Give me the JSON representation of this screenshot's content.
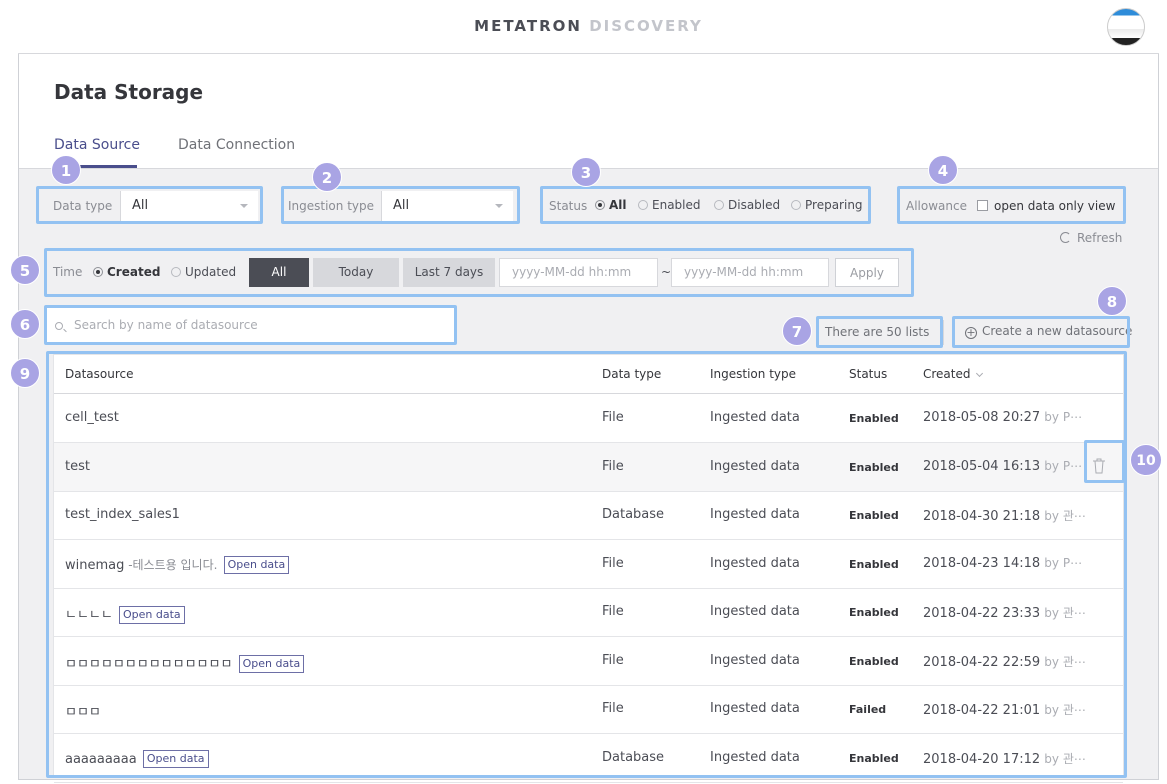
{
  "header": {
    "logo_part1": "METATRON",
    "logo_part2": "DISCOVERY"
  },
  "page": {
    "title": "Data Storage",
    "tabs": [
      {
        "label": "Data Source",
        "active": true
      },
      {
        "label": "Data Connection",
        "active": false
      }
    ]
  },
  "badges": [
    "1",
    "2",
    "3",
    "4",
    "5",
    "6",
    "7",
    "8",
    "9",
    "10"
  ],
  "filters": {
    "data_type": {
      "label": "Data type",
      "value": "All"
    },
    "ingestion_type": {
      "label": "Ingestion type",
      "value": "All"
    },
    "status": {
      "label": "Status",
      "options": [
        "All",
        "Enabled",
        "Disabled",
        "Preparing"
      ],
      "selected": "All"
    },
    "allowance": {
      "label": "Allowance",
      "checkbox_label": "open data only view",
      "checked": false
    },
    "refresh_label": "Refresh",
    "time": {
      "label": "Time",
      "options": [
        "Created",
        "Updated"
      ],
      "selected": "Created",
      "buttons": [
        "All",
        "Today",
        "Last 7 days"
      ],
      "active_button": "All",
      "from_placeholder": "yyyy-MM-dd hh:mm",
      "to_placeholder": "yyyy-MM-dd hh:mm",
      "separator": "~",
      "apply_label": "Apply"
    }
  },
  "search": {
    "placeholder": "Search by name of datasource"
  },
  "list_count": "There are 50 lists",
  "create_label": "Create a new datasource",
  "table": {
    "columns": [
      "Datasource",
      "Data type",
      "Ingestion type",
      "Status",
      "Created"
    ],
    "open_data_tag": "Open data",
    "rows": [
      {
        "name": "cell_test",
        "desc": "",
        "open": false,
        "type": "File",
        "ingestion": "Ingested data",
        "status": "Enabled",
        "created": "2018-05-08 20:27",
        "by": "by P⋯"
      },
      {
        "name": "test",
        "desc": "",
        "open": false,
        "type": "File",
        "ingestion": "Ingested data",
        "status": "Enabled",
        "created": "2018-05-04 16:13",
        "by": "by P⋯"
      },
      {
        "name": "test_index_sales1",
        "desc": "",
        "open": false,
        "type": "Database",
        "ingestion": "Ingested data",
        "status": "Enabled",
        "created": "2018-04-30 21:18",
        "by": "by 관⋯"
      },
      {
        "name": "winemag",
        "desc": " -테스트용 입니다.",
        "open": true,
        "type": "File",
        "ingestion": "Ingested data",
        "status": "Enabled",
        "created": "2018-04-23 14:18",
        "by": "by P⋯"
      },
      {
        "name": "ㄴㄴㄴㄴ",
        "desc": "",
        "open": true,
        "type": "File",
        "ingestion": "Ingested data",
        "status": "Enabled",
        "created": "2018-04-22 23:33",
        "by": "by 관⋯"
      },
      {
        "name": "ㅁㅁㅁㅁㅁㅁㅁㅁㅁㅁㅁㅁㅁㅁ",
        "desc": "",
        "open": true,
        "type": "File",
        "ingestion": "Ingested data",
        "status": "Enabled",
        "created": "2018-04-22 22:59",
        "by": "by 관⋯"
      },
      {
        "name": "ㅁㅁㅁ",
        "desc": "",
        "open": false,
        "type": "File",
        "ingestion": "Ingested data",
        "status": "Failed",
        "created": "2018-04-22 21:01",
        "by": "by 관⋯"
      },
      {
        "name": "aaaaaaaaa",
        "desc": "",
        "open": true,
        "type": "Database",
        "ingestion": "Ingested data",
        "status": "Enabled",
        "created": "2018-04-20 17:12",
        "by": "by 관⋯"
      }
    ]
  },
  "colors": {
    "accent": "#4a4e8c",
    "badge": "#a9a4e4",
    "highlight": "#93c2f2"
  }
}
